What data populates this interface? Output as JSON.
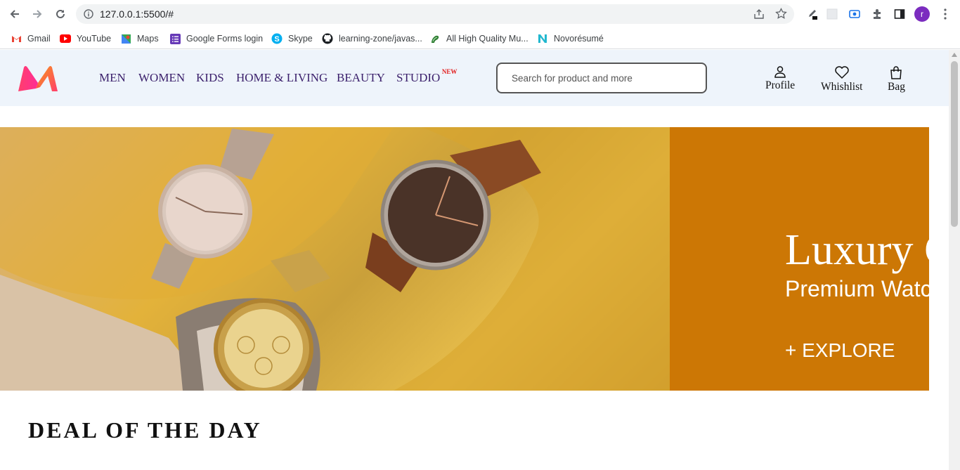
{
  "browser": {
    "url": "127.0.0.1:5500/#",
    "profile_initial": "r",
    "bookmarks": [
      {
        "label": "Gmail",
        "icon": "gmail-icon"
      },
      {
        "label": "YouTube",
        "icon": "youtube-icon"
      },
      {
        "label": "Maps",
        "icon": "maps-icon"
      },
      {
        "label": "Google Forms login",
        "icon": "forms-icon"
      },
      {
        "label": "Skype",
        "icon": "skype-icon"
      },
      {
        "label": "learning-zone/javas...",
        "icon": "github-icon"
      },
      {
        "label": "All High Quality Mu...",
        "icon": "music-icon"
      },
      {
        "label": "Novorésumé",
        "icon": "novoresume-icon"
      }
    ]
  },
  "site": {
    "logo": "M",
    "nav": [
      "MEN",
      "WOMEN",
      "KIDS",
      "HOME & LIVING",
      "BEAUTY",
      "STUDIO"
    ],
    "nav_badge": "NEW",
    "search_placeholder": "Search for product and more",
    "actions": {
      "profile": "Profile",
      "wishlist": "Whishlist",
      "bag": "Bag"
    }
  },
  "banner": {
    "title": "Luxury C",
    "subtitle": "Premium Watc",
    "cta": "+ EXPLORE",
    "panel_color": "#cc7705"
  },
  "section_title": "DEAL OF THE DAY",
  "colors": {
    "accent": "#3a1f6b",
    "header_bg": "#eef4fb"
  }
}
